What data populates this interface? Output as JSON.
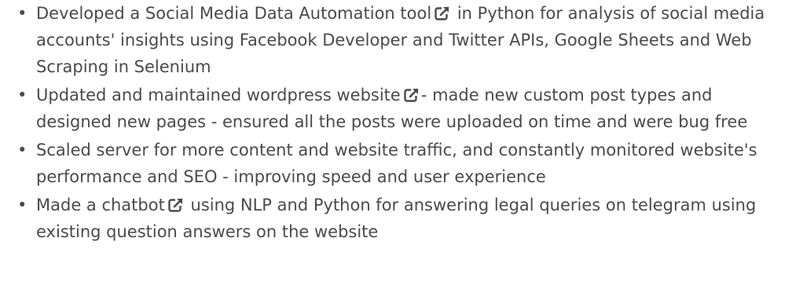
{
  "items": [
    {
      "before": "Developed a Social Media Data Automation tool",
      "after": " in Python for analysis of social media accounts' insights using Facebook Developer and Twitter APIs, Google Sheets and Web Scraping in Selenium",
      "icon": "external-link-icon"
    },
    {
      "before": "Updated and maintained wordpress website",
      "after": "- made new custom post types and designed new pages - ensured all the posts were uploaded on time and were bug free",
      "icon": "external-link-icon"
    },
    {
      "before": "Scaled server for more content and website traffic, and constantly monitored website's performance and SEO - improving speed and user experience",
      "after": "",
      "icon": ""
    },
    {
      "before": "Made a chatbot",
      "after": " using NLP and Python for answering legal queries on telegram using existing question answers on the website",
      "icon": "external-link-icon"
    }
  ],
  "colors": {
    "text": "#4a4a4a"
  }
}
